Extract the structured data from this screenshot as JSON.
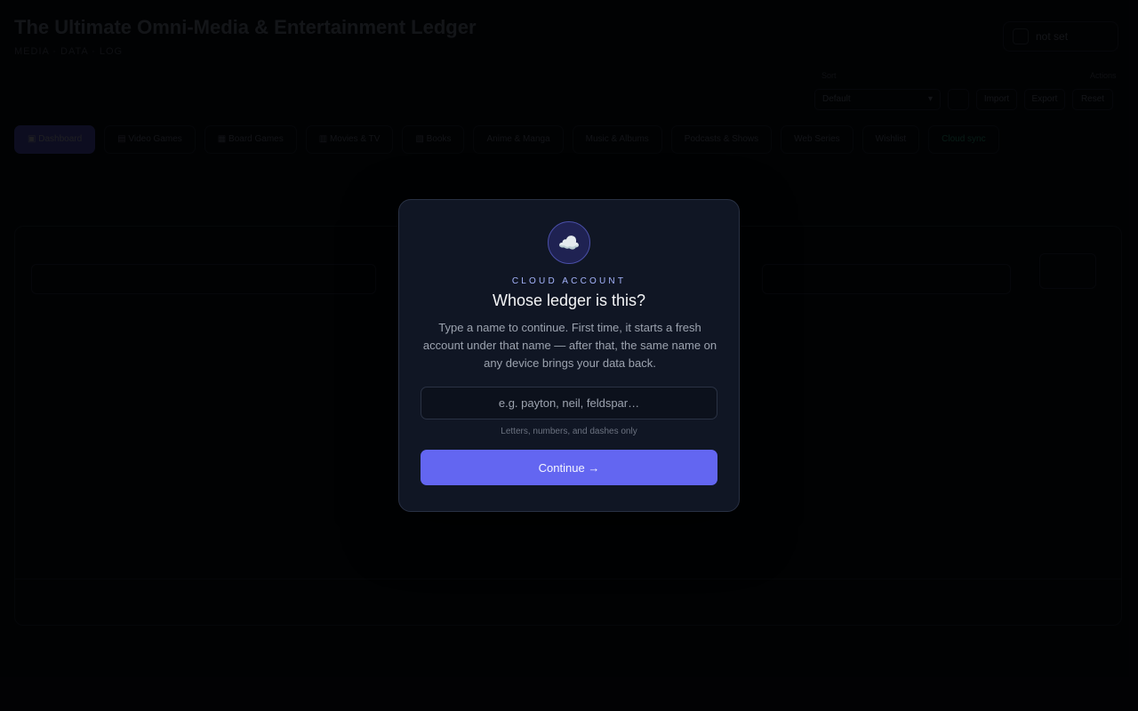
{
  "app": {
    "title": "The Ultimate Omni-Media & Entertainment Ledger",
    "subtitle": "MEDIA · DATA · LOG",
    "user_chip": "not set",
    "controls": {
      "label_left": "Sort",
      "label_right": "Actions",
      "select": "Default",
      "buttons": [
        "Import",
        "Export",
        "Reset"
      ]
    },
    "tabs": [
      {
        "label": "▣ Dashboard",
        "active": true
      },
      {
        "label": "▤ Video Games"
      },
      {
        "label": "▦ Board Games"
      },
      {
        "label": "▥ Movies & TV"
      },
      {
        "label": "▧ Books"
      },
      {
        "label": "Anime & Manga"
      },
      {
        "label": "Music & Albums"
      },
      {
        "label": "Podcasts & Shows"
      },
      {
        "label": "Web Series"
      },
      {
        "label": "Wishlist"
      },
      {
        "label": "Cloud sync",
        "green": true
      }
    ],
    "panel": {
      "field1": "",
      "field2": "",
      "field3": "",
      "row1": "",
      "row2": "",
      "row3": "",
      "row4": "",
      "row5": "",
      "footer": ""
    }
  },
  "modal": {
    "icon": "cloud-icon",
    "icon_glyph": "☁️",
    "eyebrow": "CLOUD ACCOUNT",
    "heading": "Whose ledger is this?",
    "description": "Type a name to continue. First time, it starts a fresh account under that name — after that, the same name on any device brings your data back.",
    "input": {
      "value": "",
      "placeholder": "e.g. payton, neil, feldspar…"
    },
    "hint": "Letters, numbers, and dashes only",
    "continue_label": "Continue →"
  },
  "colors": {
    "accent": "#6366f1",
    "modal_bg": "#101624",
    "eyebrow": "#a5b4fc"
  }
}
